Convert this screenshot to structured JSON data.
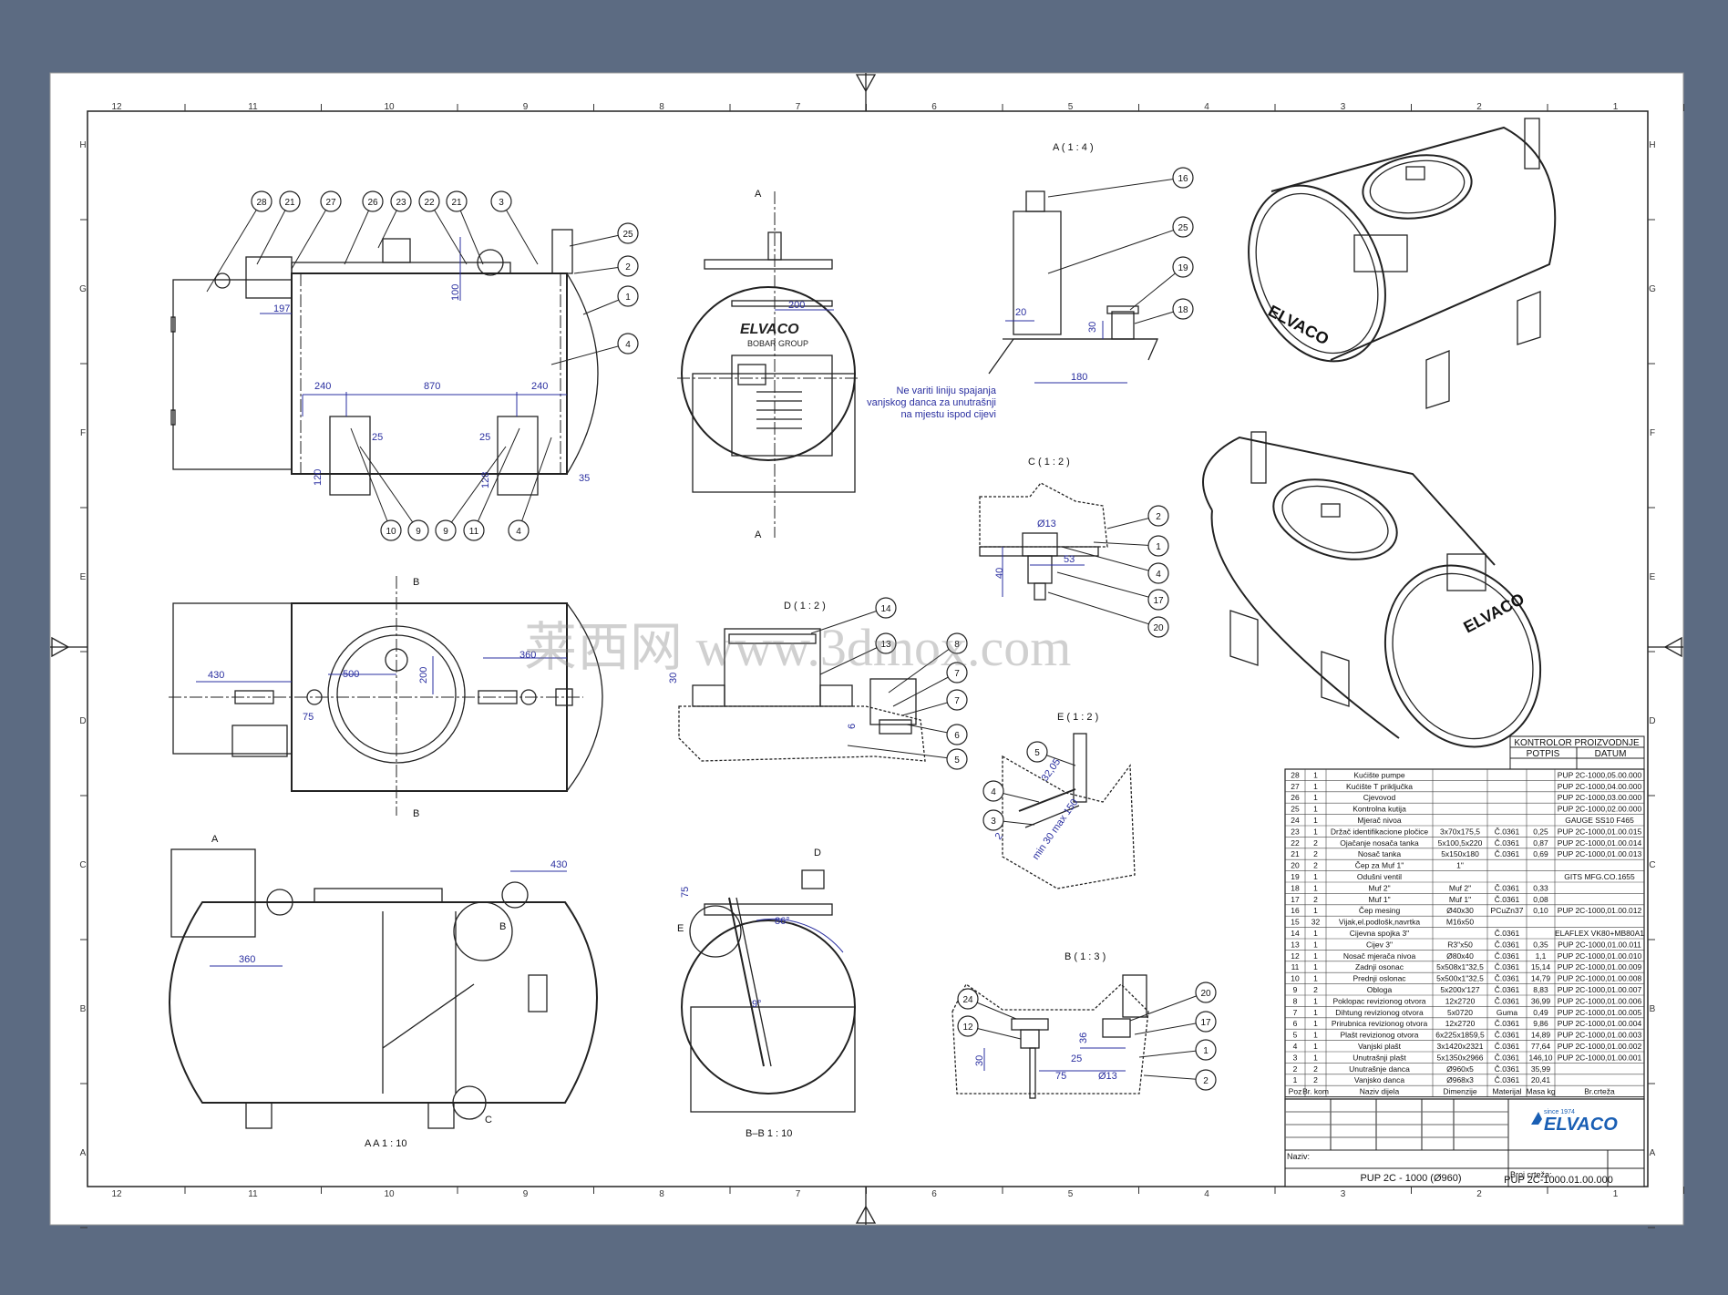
{
  "border": {
    "columns": [
      "12",
      "11",
      "10",
      "9",
      "8",
      "7",
      "6",
      "5",
      "4",
      "3",
      "2",
      "1"
    ],
    "rows": [
      "H",
      "G",
      "F",
      "E",
      "D",
      "C",
      "B",
      "A"
    ]
  },
  "views": {
    "section_a_label": "A ( 1 : 4 )",
    "section_c_label": "C ( 1 : 2 )",
    "section_d_label": "D ( 1 : 2 )",
    "section_e_label": "E ( 1 : 2 )",
    "section_b_label": "B ( 1 : 3 )",
    "view_aa_label": "A A 1 : 10",
    "view_bb_label": "B–B 1 : 10",
    "cut_a": "A",
    "cut_b": "B",
    "detail_c": "C",
    "detail_d": "D",
    "detail_e": "E",
    "detail_b": "B",
    "detail_a": "A"
  },
  "note": [
    "Ne variti liniju spajanja",
    "vanjskog danca za unutrašnji",
    "na mjestu ispod cijevi"
  ],
  "dims": {
    "d197": "197",
    "d100": "100",
    "d240a": "240",
    "d870": "870",
    "d240b": "240",
    "d25a": "25",
    "d25b": "25",
    "d120": "120",
    "d128": "128",
    "d35": "35",
    "d200": "200",
    "d430a": "430",
    "d500": "500",
    "d200b": "200",
    "d360a": "360",
    "d75": "75",
    "d430b": "430",
    "d360b": "360",
    "d20": "20",
    "d30": "30",
    "d180": "180",
    "d13a": "Ø13",
    "d53": "53",
    "d40": "40",
    "d30b": "30",
    "d6": "6",
    "d3205": "32,05",
    "d30max": "min 30 max 150",
    "d2": "2",
    "d75b": "75",
    "d86": "86°",
    "d9": "9°",
    "d36": "36",
    "d25c": "25",
    "d30c": "30",
    "d75c": "75",
    "d13b": "Ø13"
  },
  "brand": {
    "logo": "ELVACO",
    "group": "BOBAR GROUP",
    "since": "since 1974"
  },
  "watermark": "莱西网 www.3dmox.com",
  "control": {
    "title": "KONTROLOR PROIZVODNJE",
    "sign": "POTPIS",
    "date": "DATUM"
  },
  "bom_header": [
    "Poz",
    "Br. kom",
    "Naziv dijela",
    "Dimenzije",
    "Materijal",
    "Masa kg",
    "Br.crteža"
  ],
  "bom": [
    [
      "28",
      "1",
      "Kućište pumpe",
      "",
      "",
      "",
      "PUP 2C-1000,05.00.000"
    ],
    [
      "27",
      "1",
      "Kućište T priključka",
      "",
      "",
      "",
      "PUP 2C-1000,04.00.000"
    ],
    [
      "26",
      "1",
      "Cjevovod",
      "",
      "",
      "",
      "PUP 2C-1000,03.00.000"
    ],
    [
      "25",
      "1",
      "Kontrolna kutija",
      "",
      "",
      "",
      "PUP 2C-1000,02.00.000"
    ],
    [
      "24",
      "1",
      "Mjerač nivoa",
      "",
      "",
      "",
      "GAUGE SS10 F465"
    ],
    [
      "23",
      "1",
      "Držač identifikacione pločice",
      "3x70x175,5",
      "Č.0361",
      "0,25",
      "PUP 2C-1000,01.00.015"
    ],
    [
      "22",
      "2",
      "Ojačanje nosača tanka",
      "5x100,5x220",
      "Č.0361",
      "0,87",
      "PUP 2C-1000,01.00.014"
    ],
    [
      "21",
      "2",
      "Nosač tanka",
      "5x150x180",
      "Č.0361",
      "0,69",
      "PUP 2C-1000,01.00.013"
    ],
    [
      "20",
      "2",
      "Čep za Muf 1\"",
      "1\"",
      "",
      "",
      ""
    ],
    [
      "19",
      "1",
      "Odušni ventil",
      "",
      "",
      "",
      "GITS MFG.CO.1655"
    ],
    [
      "18",
      "1",
      "Muf 2\"",
      "Muf 2\"",
      "Č.0361",
      "0,33",
      ""
    ],
    [
      "17",
      "2",
      "Muf 1\"",
      "Muf 1\"",
      "Č.0361",
      "0,08",
      ""
    ],
    [
      "16",
      "1",
      "Čep mesing",
      "Ø40x30",
      "PCuZn37",
      "0,10",
      "PUP 2C-1000,01.00.012"
    ],
    [
      "15",
      "32",
      "Vijak,el.podlošk,navrtka",
      "M16x50",
      "",
      "",
      ""
    ],
    [
      "14",
      "1",
      "Cijevna spojka 3\"",
      "",
      "Č.0361",
      "",
      "ELAFLEX VK80+MB80A1"
    ],
    [
      "13",
      "1",
      "Cijev 3\"",
      "R3\"x50",
      "Č.0361",
      "0,35",
      "PUP 2C-1000,01.00.011"
    ],
    [
      "12",
      "1",
      "Nosač mjerača nivoa",
      "Ø80x40",
      "Č.0361",
      "1,1",
      "PUP 2C-1000,01.00.010"
    ],
    [
      "11",
      "1",
      "Zadnji osonac",
      "5x508x1\"32,5",
      "Č.0361",
      "15,14",
      "PUP 2C-1000,01.00.009"
    ],
    [
      "10",
      "1",
      "Prednji oslonac",
      "5x500x1\"32,5",
      "Č.0361",
      "14,79",
      "PUP 2C-1000,01.00.008"
    ],
    [
      "9",
      "2",
      "Obloga",
      "5x200x'127",
      "Č.0361",
      "8,83",
      "PUP 2C-1000,01.00.007"
    ],
    [
      "8",
      "1",
      "Poklopac revizionog otvora",
      "12x2720",
      "Č.0361",
      "36,99",
      "PUP 2C-1000,01.00.006"
    ],
    [
      "7",
      "1",
      "Dihtung revizionog otvora",
      "5x0720",
      "Guma",
      "0,49",
      "PUP 2C-1000,01.00.005"
    ],
    [
      "6",
      "1",
      "Prirubnica revizionog otvora",
      "12x2720",
      "Č.0361",
      "9,86",
      "PUP 2C-1000,01.00.004"
    ],
    [
      "5",
      "1",
      "Plašt revizionog otvora",
      "6x225x1859,5",
      "Č.0361",
      "14,89",
      "PUP 2C-1000,01.00.003"
    ],
    [
      "4",
      "1",
      "Vanjski plašt",
      "3x1420x2321",
      "Č.0361",
      "77,64",
      "PUP 2C-1000,01.00.002"
    ],
    [
      "3",
      "1",
      "Unutrašnji plašt",
      "5x1350x2966",
      "Č.0361",
      "146,10",
      "PUP 2C-1000,01.00.001"
    ],
    [
      "2",
      "2",
      "Unutrašnje danca",
      "Ø960x5",
      "Č.0361",
      "35,99",
      ""
    ],
    [
      "1",
      "2",
      "Vanjsko danca",
      "Ø968x3",
      "Č.0361",
      "20,41",
      ""
    ]
  ],
  "title_block": {
    "naming_label": "Naziv:",
    "drawing_no_label": "Broj crteža:",
    "name": "PUP 2C - 1000 (Ø960)",
    "number": "PUP 2C-1000.01.00.000"
  }
}
